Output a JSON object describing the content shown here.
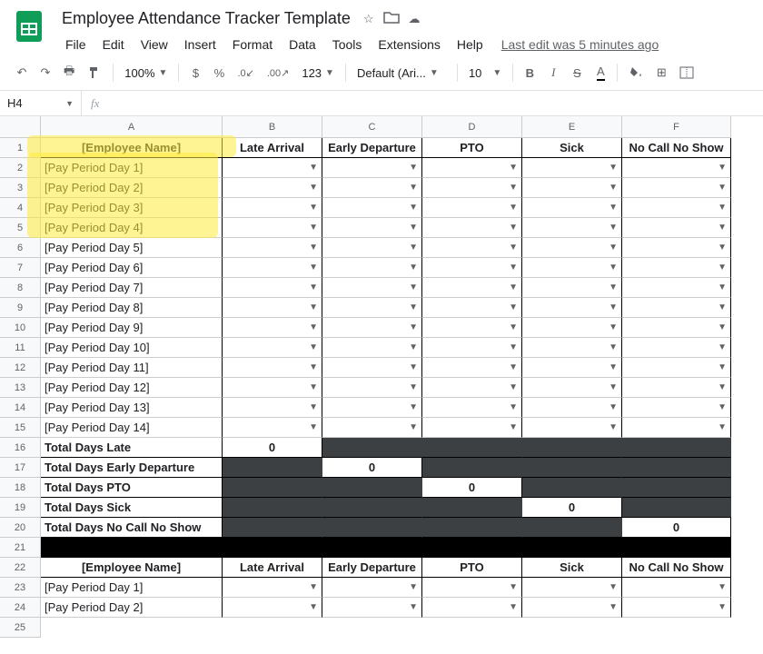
{
  "doc": {
    "title": "Employee Attendance Tracker Template"
  },
  "menus": [
    "File",
    "Edit",
    "View",
    "Insert",
    "Format",
    "Data",
    "Tools",
    "Extensions",
    "Help"
  ],
  "last_edit": "Last edit was 5 minutes ago",
  "toolbar": {
    "zoom": "100%",
    "font": "Default (Ari...",
    "size": "10",
    "format_dec1": ".0",
    "format_dec2": ".00",
    "format_123": "123"
  },
  "namebox": "H4",
  "columns": [
    "A",
    "B",
    "C",
    "D",
    "E",
    "F"
  ],
  "col_widths": [
    "col-A",
    "col-B",
    "col-C",
    "col-D",
    "col-E",
    "col-F"
  ],
  "headers": [
    "[Employee Name]",
    "Late Arrival",
    "Early Departure",
    "PTO",
    "Sick",
    "No Call No Show"
  ],
  "days": [
    "[Pay Period Day 1]",
    "[Pay Period Day 2]",
    "[Pay Period Day 3]",
    "[Pay Period Day 4]",
    "[Pay Period Day 5]",
    "[Pay Period Day 6]",
    "[Pay Period Day 7]",
    "[Pay Period Day 8]",
    "[Pay Period Day 9]",
    "[Pay Period Day 10]",
    "[Pay Period Day 11]",
    "[Pay Period Day 12]",
    "[Pay Period Day 13]",
    "[Pay Period Day 14]"
  ],
  "totals": [
    {
      "label": "Total Days Late",
      "col": 0,
      "val": "0"
    },
    {
      "label": "Total Days Early Departure",
      "col": 1,
      "val": "0"
    },
    {
      "label": "Total Days PTO",
      "col": 2,
      "val": "0"
    },
    {
      "label": "Total Days Sick",
      "col": 3,
      "val": "0"
    },
    {
      "label": "Total Days No Call No Show",
      "col": 4,
      "val": "0"
    }
  ],
  "second_days": [
    "[Pay Period Day 1]",
    "[Pay Period Day 2]"
  ],
  "icons": {
    "star": "☆",
    "folder": "▭",
    "cloud": "☁",
    "undo": "↶",
    "redo": "↷",
    "print": "🖶",
    "paint": "⟀",
    "dollar": "$",
    "percent": "%",
    "bold": "B",
    "italic": "I",
    "strike": "S",
    "textA": "A",
    "fill": "◢",
    "borders": "⊞",
    "merge": "⇔"
  }
}
